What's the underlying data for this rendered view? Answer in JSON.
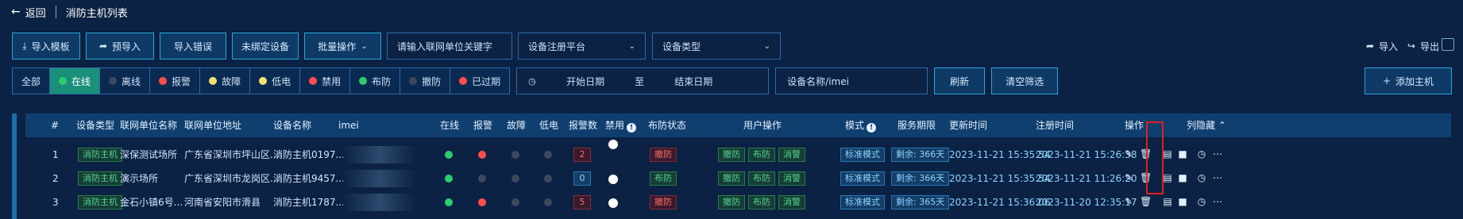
{
  "header": {
    "back_label": "返回",
    "title": "消防主机列表"
  },
  "toolbar": {
    "import_template": "导入模板",
    "pre_import": "预导入",
    "import_errors": "导入错误",
    "unbound_devices": "未绑定设备",
    "batch_ops": "批量操作",
    "keyword_placeholder": "请输入联网单位关键字",
    "platform_placeholder": "设备注册平台",
    "type_placeholder": "设备类型",
    "import_label": "导入",
    "export_label": "导出"
  },
  "status_filters": [
    {
      "label": "全部",
      "color": ""
    },
    {
      "label": "在线",
      "color": "#2ecc71"
    },
    {
      "label": "离线",
      "color": "#3a4a5c"
    },
    {
      "label": "报警",
      "color": "#ff4d4d"
    },
    {
      "label": "故障",
      "color": "#f5e06e"
    },
    {
      "label": "低电",
      "color": "#f5e06e"
    },
    {
      "label": "禁用",
      "color": "#ff4d4d"
    },
    {
      "label": "布防",
      "color": "#2ecc71"
    },
    {
      "label": "撤防",
      "color": "#3a4a5c"
    },
    {
      "label": "已过期",
      "color": "#ff4d4d"
    }
  ],
  "filters": {
    "start_date": "开始日期",
    "to": "至",
    "end_date": "结束日期",
    "device_search_placeholder": "设备名称/imei",
    "refresh": "刷新",
    "clear": "清空筛选",
    "add_host": "添加主机"
  },
  "table": {
    "headers": {
      "index": "#",
      "device_type": "设备类型",
      "unit_name": "联网单位名称",
      "unit_address": "联网单位地址",
      "device_name": "设备名称",
      "imei": "imei",
      "online": "在线",
      "alarm": "报警",
      "fault": "故障",
      "low_power": "低电",
      "alarm_count": "报警数",
      "disabled": "禁用",
      "defense": "布防状态",
      "user_ops": "用户操作",
      "mode": "模式",
      "service_term": "服务期限",
      "update_time": "更新时间",
      "register_time": "注册时间",
      "actions": "操作",
      "hidden_cols": "列隐藏"
    },
    "rows": [
      {
        "index": "1",
        "device_type": "消防主机",
        "unit_name": "深保测试场所",
        "unit_address": "广东省深圳市坪山区...",
        "device_name": "消防主机0197...",
        "online": "#2ecc71",
        "alarm": "#ff4d4d",
        "fault": "#3a4a5c",
        "low_power": "#3a4a5c",
        "alarm_count": "2",
        "alarm_count_style": "red",
        "defense": "撤防",
        "defense_style": "red",
        "op1": "撤防",
        "op2": "布防",
        "op3": "消警",
        "mode": "标准模式",
        "service": "剩余: 366天",
        "update_time": "2023-11-21 15:35:54",
        "register_time": "2023-11-21 15:26:38"
      },
      {
        "index": "2",
        "device_type": "消防主机",
        "unit_name": "演示场所",
        "unit_address": "广东省深圳市龙岗区...",
        "device_name": "消防主机9457...",
        "online": "#2ecc71",
        "alarm": "#3a4a5c",
        "fault": "#3a4a5c",
        "low_power": "#3a4a5c",
        "alarm_count": "0",
        "alarm_count_style": "blue",
        "defense": "布防",
        "defense_style": "green",
        "op1": "撤防",
        "op2": "布防",
        "op3": "消警",
        "mode": "标准模式",
        "service": "剩余: 366天",
        "update_time": "2023-11-21 15:35:54",
        "register_time": "2023-11-21 11:26:20"
      },
      {
        "index": "3",
        "device_type": "消防主机",
        "unit_name": "金石小镇6号...",
        "unit_address": "河南省安阳市滑县",
        "device_name": "消防主机1787...",
        "online": "#2ecc71",
        "alarm": "#ff4d4d",
        "fault": "#3a4a5c",
        "low_power": "#3a4a5c",
        "alarm_count": "5",
        "alarm_count_style": "red",
        "defense": "撤防",
        "defense_style": "red",
        "op1": "撤防",
        "op2": "布防",
        "op3": "消警",
        "mode": "标准模式",
        "service": "剩余: 365天",
        "update_time": "2023-11-21 15:36:06",
        "register_time": "2023-11-20 12:35:17"
      }
    ]
  }
}
